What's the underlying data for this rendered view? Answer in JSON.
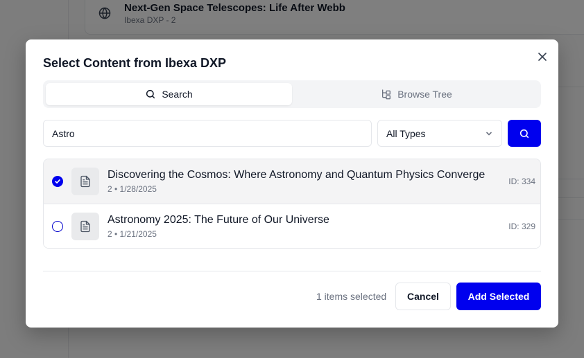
{
  "background": {
    "card_title": "Next-Gen Space Telescopes: Life After Webb",
    "card_subtitle": "Ibexa DXP - 2"
  },
  "dialog": {
    "title": "Select Content from Ibexa DXP",
    "tabs": [
      {
        "label": "Search",
        "active": true
      },
      {
        "label": "Browse Tree",
        "active": false
      }
    ],
    "search": {
      "value": "Astro",
      "type_filter": "All Types"
    },
    "results": [
      {
        "title": "Discovering the Cosmos: Where Astronomy and Quantum Physics Converge",
        "meta": "2 • 1/28/2025",
        "id": "ID: 334",
        "selected": true
      },
      {
        "title": "Astronomy 2025: The Future of Our Universe",
        "meta": "2 • 1/21/2025",
        "id": "ID: 329",
        "selected": false
      }
    ],
    "footer": {
      "selected_count": "1 items selected",
      "cancel_label": "Cancel",
      "add_label": "Add Selected"
    }
  },
  "colors": {
    "accent": "#0000ee",
    "overlay": "rgba(0,0,0,0.5)"
  }
}
